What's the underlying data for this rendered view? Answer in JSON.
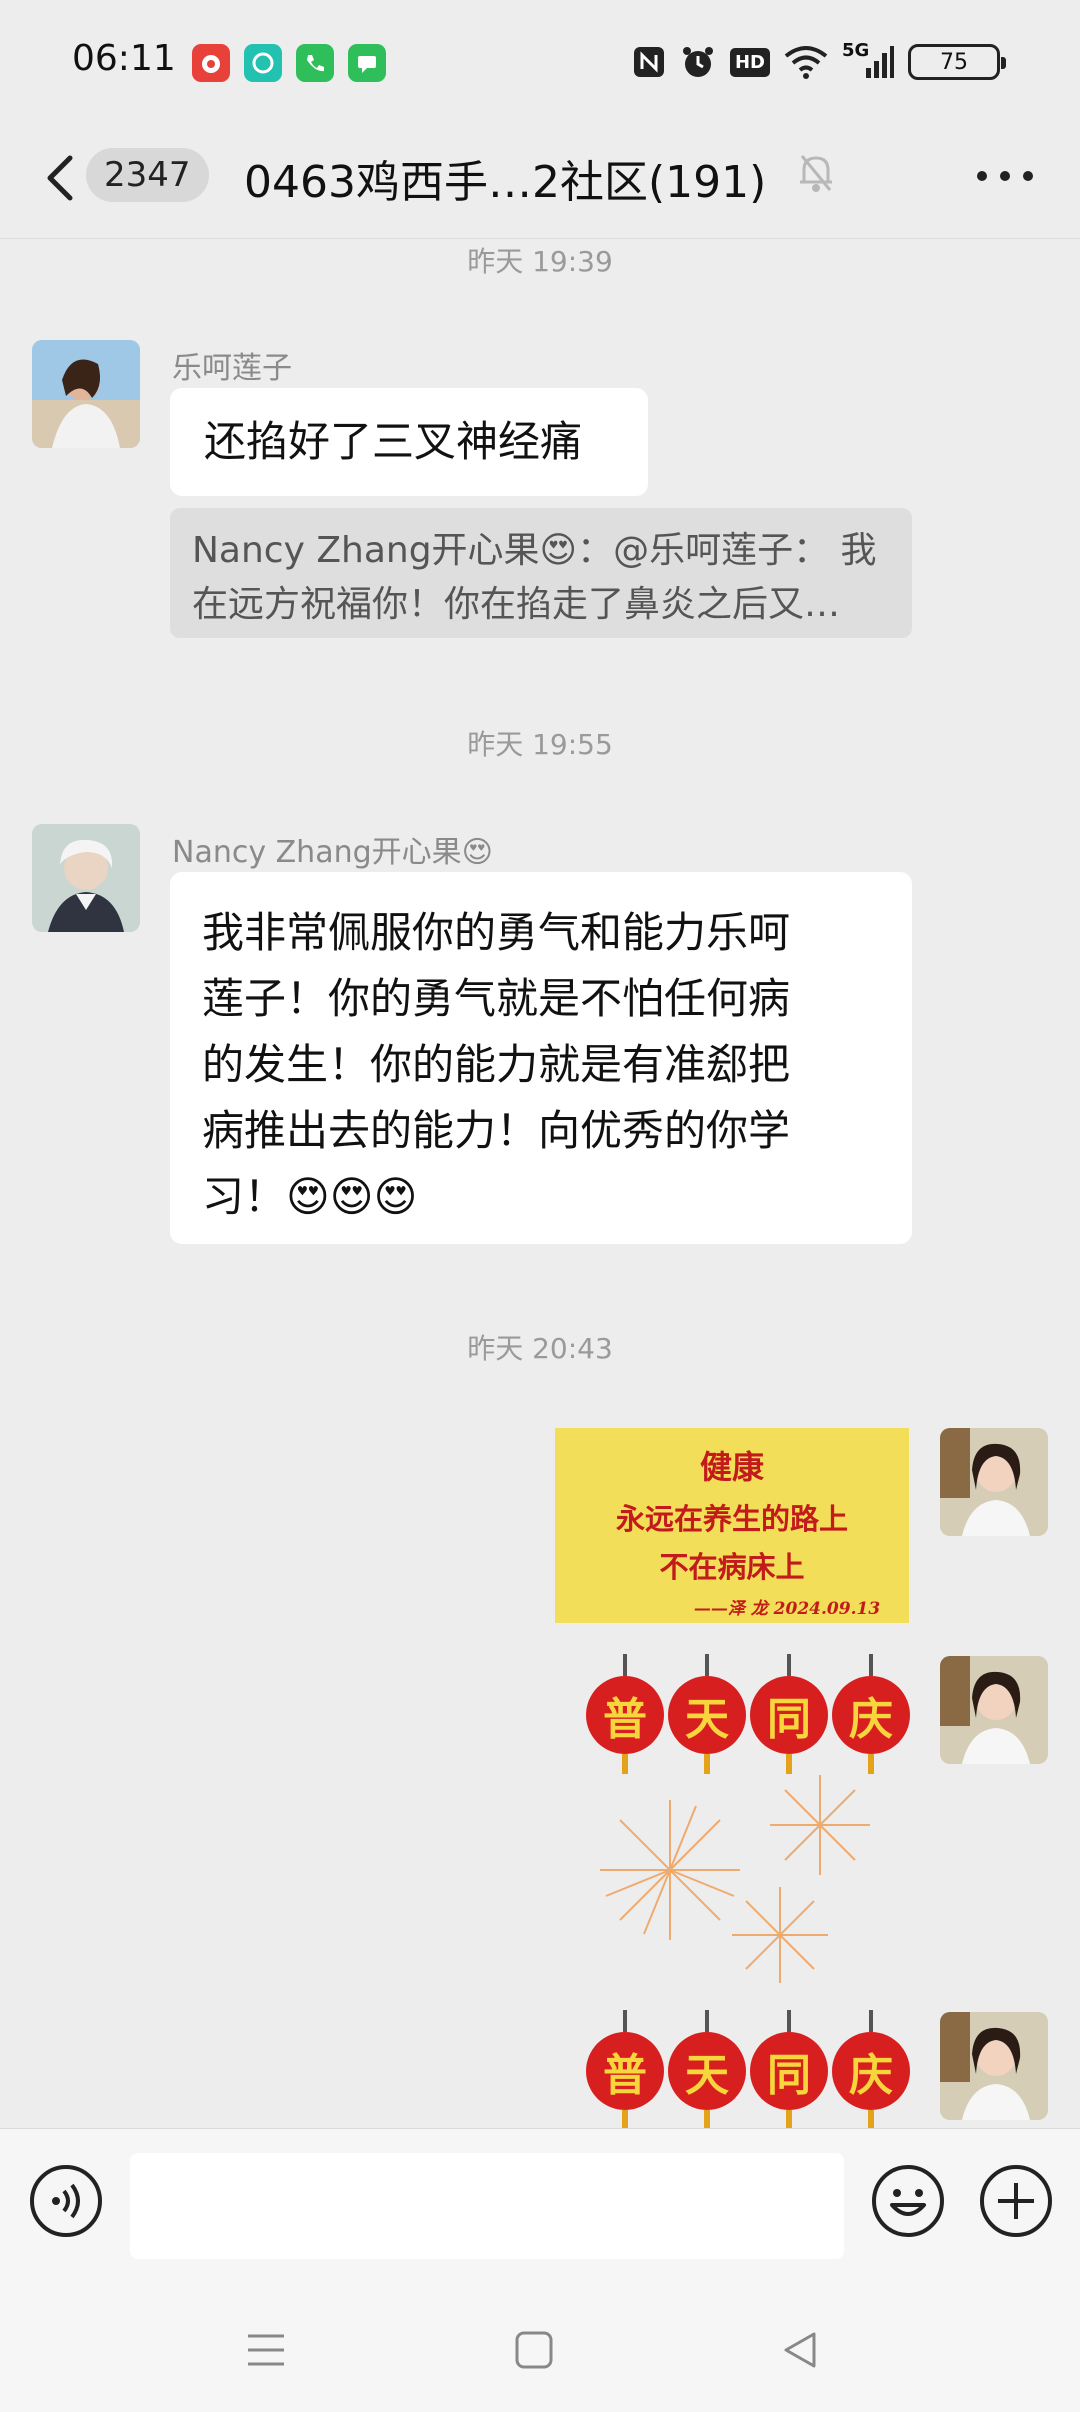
{
  "status_bar": {
    "time": "06:11",
    "network": "5G",
    "battery": "75",
    "hd_label": "HD"
  },
  "header": {
    "unread_count": "2347",
    "title": "0463鸡西手…2社区(191)"
  },
  "messages": {
    "ts1": "昨天 19:39",
    "msg1": {
      "sender": "乐呵莲子",
      "text": "还掐好了三叉神经痛",
      "quote_line1": "Nancy Zhang开心果😍：@乐呵莲子： 我",
      "quote_line2": "在远方祝福你！你在掐走了鼻炎之后又…"
    },
    "ts2": "昨天 19:55",
    "msg2": {
      "sender": "Nancy Zhang开心果😍",
      "line1": "我非常佩服你的勇气和能力乐呵",
      "line2": "莲子！你的勇气就是不怕任何病",
      "line3": "的发生！你的能力就是有准郄把",
      "line4": "病推出去的能力！向优秀的你学",
      "line5": "习！😍😍😍"
    },
    "ts3": "昨天 20:43",
    "sticker1": {
      "line1": "健康",
      "line2": "永远在养生的路上",
      "line3": "不在病床上",
      "line4": "——泽 龙 2024.09.13"
    },
    "lantern_chars": [
      "普",
      "天",
      "同",
      "庆"
    ]
  },
  "input": {
    "value": ""
  },
  "colors": {
    "background": "#ededed",
    "bubble": "#ffffff",
    "sticker_yellow": "#f2de58",
    "lantern_red": "#d81f1f",
    "lantern_text": "#f7d53d"
  },
  "icons": {
    "back": "chevron-left-icon",
    "mute": "bell-off-icon",
    "more": "more-dots-icon",
    "voice": "voice-icon",
    "emoji": "emoji-icon",
    "add": "plus-circle-icon"
  }
}
